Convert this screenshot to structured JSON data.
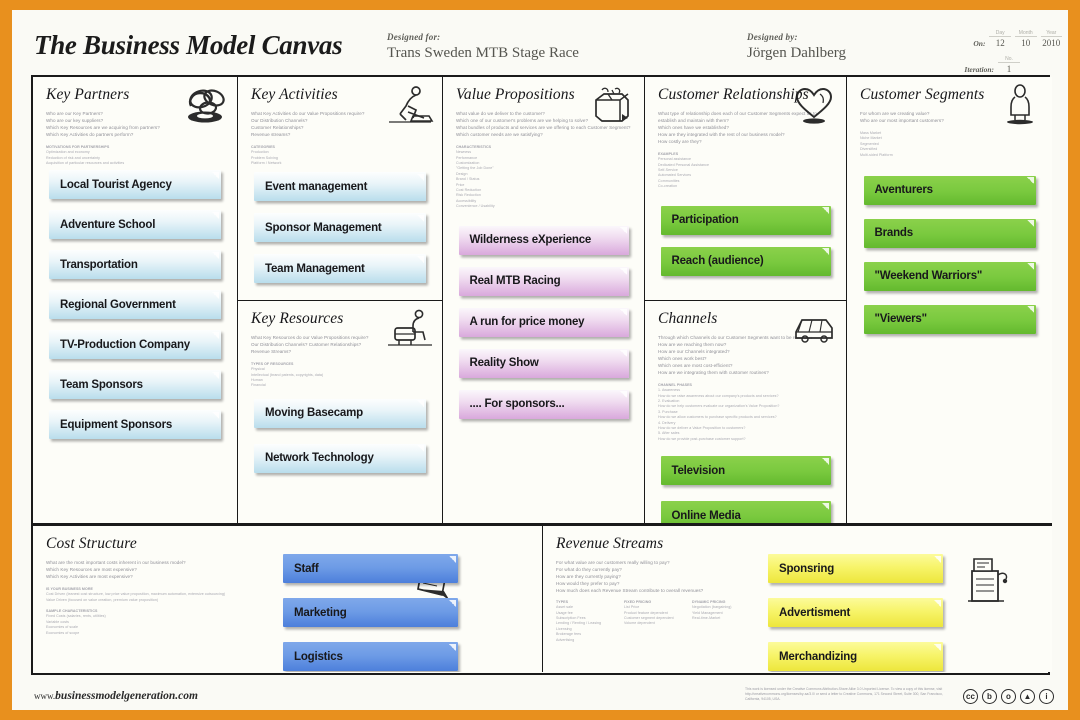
{
  "header": {
    "title": "The Business Model Canvas",
    "designed_for_label": "Designed for:",
    "designed_for_value": "Trans Sweden MTB Stage Race",
    "designed_by_label": "Designed by:",
    "designed_by_value": "Jörgen Dahlberg",
    "date_label": "On:",
    "date_day_tick": "Day",
    "date_month_tick": "Month",
    "date_year_tick": "Year",
    "date_day": "12",
    "date_month": "10",
    "date_year": "2010",
    "iteration_label": "Iteration:",
    "iteration_tick": "No.",
    "iteration_value": "1"
  },
  "blocks": {
    "key_partners": {
      "title": "Key Partners",
      "icon": "chain-links-icon",
      "questions": "Who are our Key Partners?\nWho are our key suppliers?\nWhich Key Resources are we acquiring from partners?\nWhich Key Activities do partners perform?",
      "examples_heading": "MOTIVATIONS FOR PARTNERSHIPS",
      "examples": "Optimization and economy\nReduction of risk and uncertainty\nAcquisition of particular resources and activities",
      "cards": [
        {
          "label": "Local Tourist Agency",
          "color": "blue"
        },
        {
          "label": "Adventure School",
          "color": "blue"
        },
        {
          "label": "Transportation",
          "color": "blue"
        },
        {
          "label": "Regional Government",
          "color": "blue"
        },
        {
          "label": "TV-Production Company",
          "color": "blue"
        },
        {
          "label": "Team Sponsors",
          "color": "blue"
        },
        {
          "label": "Equipment Sponsors",
          "color": "blue"
        }
      ]
    },
    "key_activities": {
      "title": "Key Activities",
      "icon": "worker-icon",
      "questions": "What Key Activities do our Value Propositions require?\nOur Distribution Channels?\nCustomer Relationships?\nRevenue streams?",
      "examples_heading": "CATEGORIES",
      "examples": "Production\nProblem Solving\nPlatform / Network",
      "cards": [
        {
          "label": "Event management",
          "color": "blue"
        },
        {
          "label": "Sponsor Management",
          "color": "blue"
        },
        {
          "label": "Team Management",
          "color": "blue"
        }
      ]
    },
    "key_resources": {
      "title": "Key Resources",
      "icon": "crane-icon",
      "questions": "What Key Resources do our Value Propositions require?\nOur Distribution Channels? Customer Relationships?\nRevenue Streams?",
      "examples_heading": "TYPES OF RESOURCES",
      "examples": "Physical\nIntellectual (brand patents, copyrights, data)\nHuman\nFinancial",
      "cards": [
        {
          "label": "Moving Basecamp",
          "color": "blue"
        },
        {
          "label": "Network Technology",
          "color": "blue"
        }
      ]
    },
    "value_propositions": {
      "title": "Value Propositions",
      "icon": "gift-icon",
      "questions": "What value do we deliver to the customer?\nWhich one of our customer's problems are we helping to solve?\nWhat bundles of products and services are we offering to each Customer Segment?\nWhich customer needs are we satisfying?",
      "examples_heading": "CHARACTERISTICS",
      "examples": "Newness\nPerformance\nCustomization\n\"Getting the Job Done\"\nDesign\nBrand / Status\nPrice\nCost Reduction\nRisk Reduction\nAccessibility\nConvenience / Usability",
      "cards": [
        {
          "label": "Wilderness eXperience",
          "color": "purple"
        },
        {
          "label": "Real MTB Racing",
          "color": "purple"
        },
        {
          "label": "A run for price money",
          "color": "purple"
        },
        {
          "label": "Reality Show",
          "color": "purple"
        },
        {
          "label": ".... For sponsors...",
          "color": "purple"
        }
      ]
    },
    "customer_relationships": {
      "title": "Customer Relationships",
      "icon": "heart-icon",
      "questions": "What type of relationship does each of our Customer Segments expect us to establish and maintain with them?\nWhich ones have we established?\nHow are they integrated with the rest of our business model?\nHow costly are they?",
      "examples_heading": "EXAMPLES",
      "examples": "Personal assistance\nDedicated Personal Assistance\nSelf-Service\nAutomated Services\nCommunities\nCo-creation",
      "cards": [
        {
          "label": "Participation",
          "color": "green"
        },
        {
          "label": "Reach (audience)",
          "color": "green"
        }
      ]
    },
    "channels": {
      "title": "Channels",
      "icon": "truck-icon",
      "questions": "Through which Channels do our Customer Segments want to be reached?\nHow are we reaching them now?\nHow are our Channels integrated?\nWhich ones work best?\nWhich ones are most cost-efficient?\nHow are we integrating them with customer routines?",
      "examples_heading": "CHANNEL PHASES",
      "examples": "1. Awareness\nHow do we raise awareness about our company's products and services?\n2. Evaluation\nHow do we help customers evaluate our organization's Value Proposition?\n3. Purchase\nHow do we allow customers to purchase specific products and services?\n4. Delivery\nHow do we deliver a Value Proposition to customers?\n5. After sales\nHow do we provide post-purchase customer support?",
      "cards": [
        {
          "label": "Television",
          "color": "green"
        },
        {
          "label": "Online Media",
          "color": "green"
        }
      ]
    },
    "customer_segments": {
      "title": "Customer Segments",
      "icon": "person-icon",
      "questions": "For whom are we creating value?\nWho are our most important customers?",
      "examples_heading": "",
      "examples": "Mass Market\nNiche Market\nSegmented\nDiversified\nMulti-sided Platform",
      "cards": [
        {
          "label": "Aventurers",
          "color": "green"
        },
        {
          "label": "Brands",
          "color": "green"
        },
        {
          "label": "\"Weekend Warriors\"",
          "color": "green"
        },
        {
          "label": "\"Viewers\"",
          "color": "green"
        }
      ]
    },
    "cost_structure": {
      "title": "Cost Structure",
      "icon": "receipt-icon",
      "questions": "What are the most important costs inherent in our business model?\nWhich Key Resources are most expensive?\nWhich Key Activities are most expensive?",
      "examples_heading": "IS YOUR BUSINESS MORE",
      "examples": "Cost Driven (leanest cost structure, low price value proposition, maximum automation, extensive outsourcing)\nValue Driven (focused on value creation, premium value proposition)",
      "examples_heading2": "SAMPLE CHARACTERISTICS",
      "examples2": "Fixed Costs (salaries, rents, utilities)\nVariable costs\nEconomies of scale\nEconomies of scope",
      "cards": [
        {
          "label": "Staff",
          "color": "blue2"
        },
        {
          "label": "Marketing",
          "color": "blue2"
        },
        {
          "label": "Logistics",
          "color": "blue2"
        }
      ]
    },
    "revenue_streams": {
      "title": "Revenue Streams",
      "icon": "cash-register-icon",
      "questions": "For what value are our customers really willing to pay?\nFor what do they currently pay?\nHow are they currently paying?\nHow would they prefer to pay?\nHow much does each Revenue Stream contribute to overall revenues?",
      "examples_heading": "TYPES",
      "examples": "Asset sale\nUsage fee\nSubscription Fees\nLending / Renting / Leasing\nLicensing\nBrokerage fees\nAdvertising",
      "examples_heading2": "FIXED PRICING",
      "examples2": "List Price\nProduct feature dependent\nCustomer segment dependent\nVolume dependent",
      "examples_heading3": "DYNAMIC PRICING",
      "examples3": "Negotiation (bargaining)\nYield Management\nReal-time-Market",
      "cards": [
        {
          "label": "Sponsring",
          "color": "yellow"
        },
        {
          "label": "Advertisment",
          "color": "yellow"
        },
        {
          "label": "Merchandizing",
          "color": "yellow"
        }
      ]
    }
  },
  "footer": {
    "url_prefix": "www.",
    "url": "businessmodelgeneration.com",
    "legal": "This work is licensed under the Creative Commons Attribution-Share Alike 3.0 Unported License. To view a copy of this license, visit http://creativecommons.org/licenses/by-sa/3.0/ or send a letter to Creative Commons, 171 Second Street, Suite 300, San Francisco, California, 94105, USA.",
    "cc_icons": [
      "cc-icon",
      "cc-by-icon",
      "cc-sa-icon",
      "cc-nd-icon",
      "cc-person-icon"
    ]
  },
  "colors": {
    "border": "#E8901E",
    "paper": "#FAFAF5",
    "card_blue": "#B9DDEC",
    "card_purple": "#D9A8DC",
    "card_green": "#79C93E",
    "card_blue_dark": "#6E9CE6",
    "card_yellow": "#F7F46A"
  }
}
